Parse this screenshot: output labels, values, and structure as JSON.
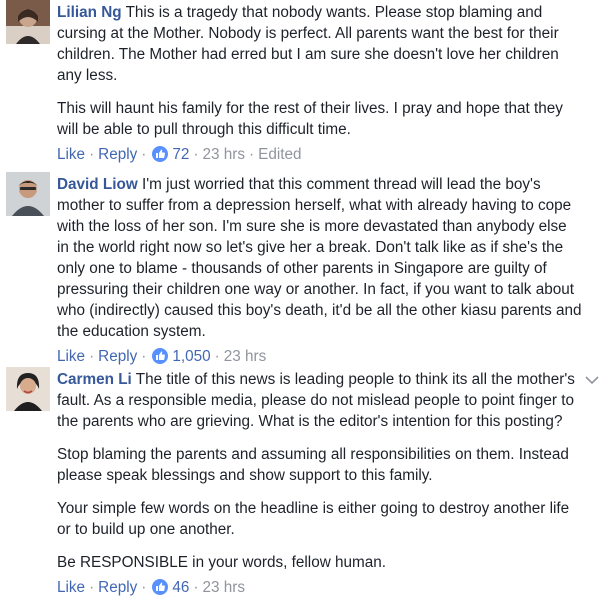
{
  "comments": [
    {
      "author": "Lilian Ng",
      "paragraphs": [
        "This is a tragedy that nobody wants. Please stop blaming and cursing at the Mother. Nobody is perfect. All parents want the best for their children. The Mother had erred but I am sure she doesn't love her children any less.",
        "This will haunt his family for the rest of their lives. I pray and hope that they will be able to pull through this difficult time."
      ],
      "like_label": "Like",
      "reply_label": "Reply",
      "reaction_count": "72",
      "time": "23 hrs",
      "edited": "Edited"
    },
    {
      "author": "David Liow",
      "paragraphs": [
        "I'm just worried that this comment thread will lead the boy's mother to suffer from a depression herself, what with already having to cope with the loss of her son. I'm sure she is more devastated than anybody else in the world right now so let's give her a break. Don't talk like as if she's the only one to blame - thousands of other parents in Singapore are guilty of pressuring their children one way or another. In fact, if you want to talk about who (indirectly) caused this boy's death, it'd be all the other kiasu parents and the education system."
      ],
      "like_label": "Like",
      "reply_label": "Reply",
      "reaction_count": "1,050",
      "time": "23 hrs"
    },
    {
      "author": "Carmen Li",
      "paragraphs": [
        "The title of this news is leading people to think its all the mother's fault. As a responsible media, please do not mislead people to point finger to the parents who are grieving. What is the editor's intention for this posting?",
        "Stop blaming the parents and assuming all responsibilities on them. Instead please speak blessings and show support to this family.",
        "Your simple few words on the headline is either going to destroy another life or to build up one another.",
        "Be RESPONSIBLE in your words, fellow human."
      ],
      "like_label": "Like",
      "reply_label": "Reply",
      "reaction_count": "46",
      "time": "23 hrs"
    }
  ],
  "icons": {
    "reaction": "thumbs-up-icon",
    "options": "chevron-down-icon"
  },
  "colors": {
    "author_link": "#365899",
    "action_link": "#4267b2",
    "meta_text": "#90949c",
    "like_badge": "#5890ff",
    "body_text": "#1d2129"
  }
}
